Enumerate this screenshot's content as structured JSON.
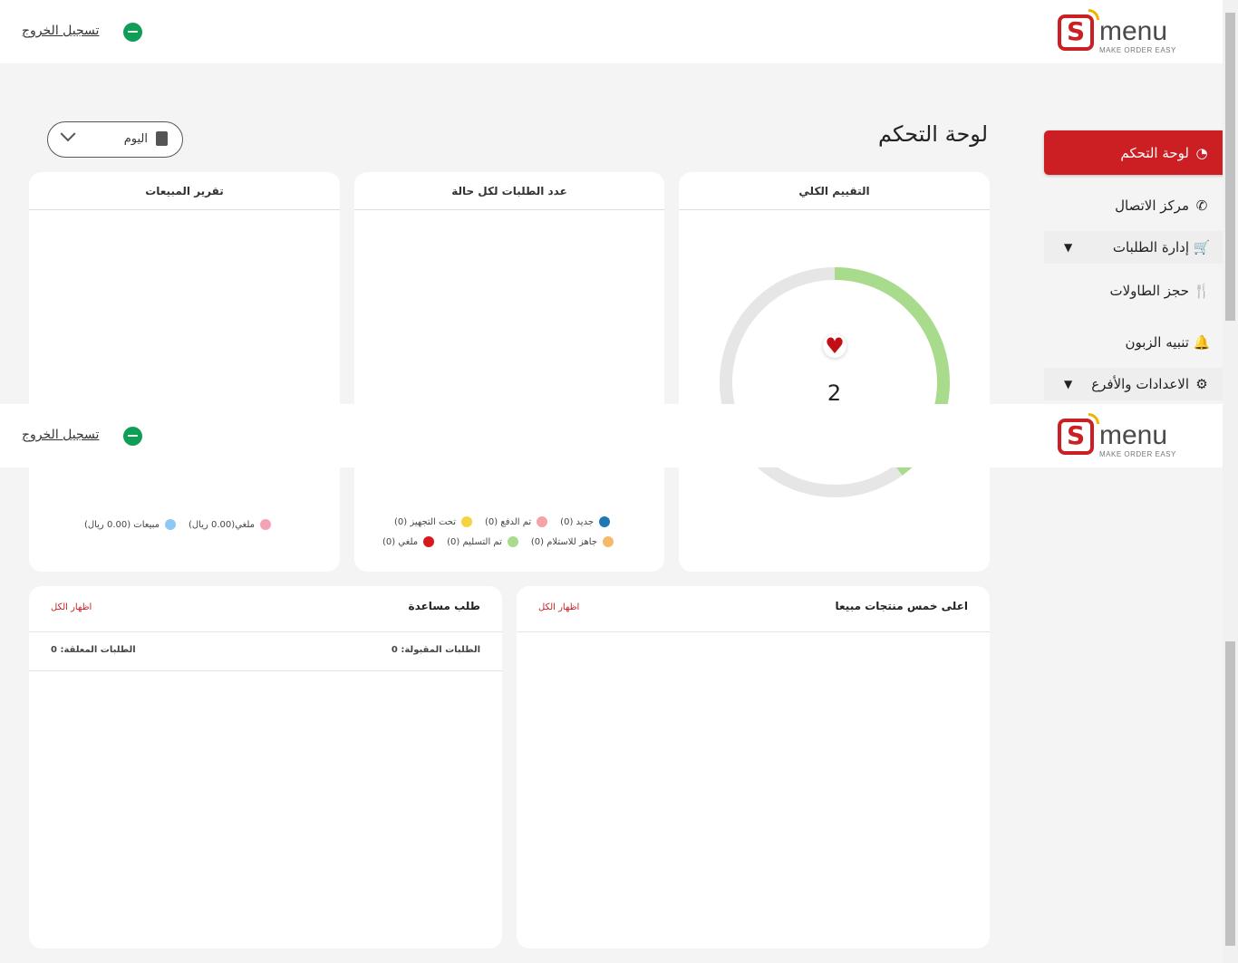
{
  "brand": {
    "name": "menu",
    "tagline": "MAKE ORDER EASY",
    "accent": "#cc1f24"
  },
  "header": {
    "logout_label": "تسجيل الخروج"
  },
  "sidebar": {
    "items": [
      {
        "label": "لوحة التحكم",
        "icon": "pie-chart-icon"
      },
      {
        "label": "مركز الاتصال",
        "icon": "phone-icon"
      },
      {
        "label": "إدارة الطلبات",
        "icon": "cart-icon"
      },
      {
        "label": "حجز الطاولات",
        "icon": "utensils-icon"
      },
      {
        "label": "تنبيه الزبون",
        "icon": "bell-icon"
      },
      {
        "label": "الاعدادات والأفرع",
        "icon": "gear-icon"
      }
    ]
  },
  "main": {
    "title": "لوحة التحكم",
    "date_filter": {
      "selected": "اليوم"
    }
  },
  "cards": {
    "rating": {
      "title": "التقييم الكلي",
      "value": "2",
      "gauge_fraction": 0.4
    },
    "status": {
      "title": "عدد الطلبات لكل حالة",
      "legend": [
        {
          "label": "جديد (0)",
          "color": "#1f77b4"
        },
        {
          "label": "تم الدفع (0)",
          "color": "#f4a3a8"
        },
        {
          "label": "تحت التجهيز (0)",
          "color": "#f5d33f"
        },
        {
          "label": "جاهز للاستلام (0)",
          "color": "#f5b96b"
        },
        {
          "label": "تم التسليم (0)",
          "color": "#a8dc8c"
        },
        {
          "label": "ملغي (0)",
          "color": "#d7191c"
        }
      ]
    },
    "sales": {
      "title": "تقرير المبيعات",
      "legend": [
        {
          "label": "ملغي(0.00 ريال)",
          "color": "#f4a3b5"
        },
        {
          "label": "مبيعات (0.00 ريال)",
          "color": "#8ec8f5"
        }
      ]
    },
    "top_products": {
      "title": "اعلى خمس منتجات مبيعا",
      "show_all": "اظهار الكل"
    },
    "help_requests": {
      "title": "طلب مساعدة",
      "show_all": "اظهار الكل",
      "accepted": "الطلبات المقبولة: 0",
      "pending": "الطلبات المعلقة: 0"
    }
  }
}
